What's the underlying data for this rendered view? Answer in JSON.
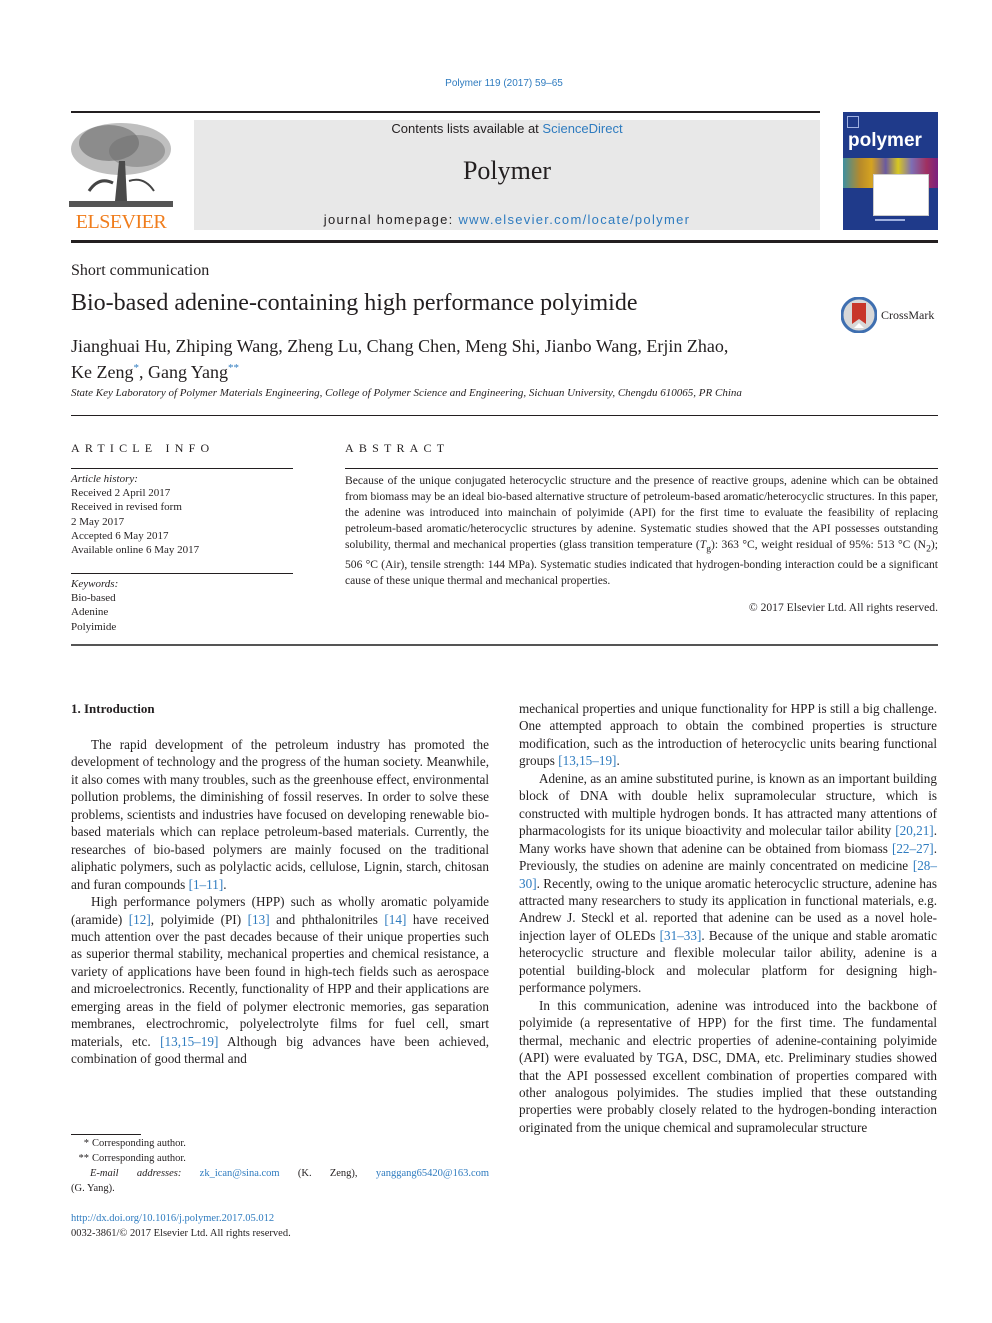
{
  "header": {
    "journal_ref": "Polymer 119 (2017) 59–65",
    "publisher_logo_text": "ELSEVIER",
    "contents_prefix": "Contents lists available at ",
    "contents_link": "ScienceDirect",
    "journal_name": "Polymer",
    "homepage_prefix": "journal homepage: ",
    "homepage_link": "www.elsevier.com/locate/polymer",
    "cover_title": "polymer",
    "brand_color": "#f07d1c",
    "link_color": "#2e7bbf"
  },
  "article": {
    "type": "Short communication",
    "title": "Bio-based adenine-containing high performance polyimide",
    "crossmark_label": "CrossMark",
    "authors_line1": "Jianghuai Hu, Zhiping Wang, Zheng Lu, Chang Chen, Meng Shi, Jianbo Wang, Erjin Zhao,",
    "author_zeng": "Ke Zeng",
    "author_zeng_mark": "*",
    "author_sep": ", ",
    "author_yang": "Gang Yang",
    "author_yang_mark": "**",
    "affiliation": "State Key Laboratory of Polymer Materials Engineering, College of Polymer Science and Engineering, Sichuan University, Chengdu 610065, PR China"
  },
  "article_info": {
    "heading": "ARTICLE INFO",
    "history_heading": "Article history:",
    "history": [
      "Received 2 April 2017",
      "Received in revised form",
      "2 May 2017",
      "Accepted 6 May 2017",
      "Available online 6 May 2017"
    ],
    "keywords_heading": "Keywords:",
    "keywords": [
      "Bio-based",
      "Adenine",
      "Polyimide"
    ]
  },
  "abstract": {
    "heading": "ABSTRACT",
    "p1": "Because of the unique conjugated heterocyclic structure and the presence of reactive groups, adenine which can be obtained from biomass may be an ideal bio-based alternative structure of petroleum-based aromatic/heterocyclic structures. In this paper, the adenine was introduced into mainchain of polyimide (API) for the first time to evaluate the feasibility of replacing petroleum-based aromatic/heterocyclic structures by adenine. Systematic studies showed that the API possesses outstanding solubility, thermal and mechanical properties (glass transition temperature (",
    "tg_symbol": "T",
    "tg_sub": "g",
    "p2": "): 363 °C, weight residual of 95%: 513 °C (N",
    "n2_sub": "2",
    "p3": "); 506 °C (Air), tensile strength: 144 MPa). Systematic studies indicated that hydrogen-bonding interaction could be a significant cause of these unique thermal and mechanical properties.",
    "copyright": "© 2017 Elsevier Ltd. All rights reserved."
  },
  "body": {
    "section_heading": "1.  Introduction",
    "left": {
      "p1": "The rapid development of the petroleum industry has promoted the development of technology and the progress of the human society. Meanwhile, it also comes with many troubles, such as the greenhouse effect, environmental pollution problems, the diminishing of fossil reserves. In order to solve these problems, scientists and industries have focused on developing renewable bio-based materials which can replace petroleum-based materials. Currently, the researches of bio-based polymers are mainly focused on the traditional aliphatic polymers, such as polylactic acids, cellulose, Lignin, starch, chitosan and furan compounds ",
      "p1_ref": "[1–11]",
      "p1_end": ".",
      "p2_a": "High performance polymers (HPP) such as wholly aromatic polyamide (aramide) ",
      "p2_ref1": "[12]",
      "p2_b": ", polyimide (PI) ",
      "p2_ref2": "[13]",
      "p2_c": " and phthalonitriles ",
      "p2_ref3": "[14]",
      "p2_d": " have received much attention over the past decades because of their unique properties such as superior thermal stability, mechanical properties and chemical resistance, a variety of applications have been found in high-tech fields such as aerospace and microelectronics. Recently, functionality of HPP and their applications are emerging areas in the field of polymer electronic memories, gas separation membranes, electrochromic, polyelectrolyte films for fuel cell, smart materials, etc. ",
      "p2_ref4": "[13,15–19]",
      "p2_e": " Although big advances have been achieved, combination of good thermal and"
    },
    "right": {
      "p0_a": "mechanical properties and unique functionality for HPP is still a big challenge. One attempted approach to obtain the combined properties is structure modification, such as the introduction of heterocyclic units bearing functional groups ",
      "p0_ref": "[13,15–19]",
      "p0_end": ".",
      "p1_a": "Adenine, as an amine substituted purine, is known as an important building block of DNA with double helix supramolecular structure, which is constructed with multiple hydrogen bonds. It has attracted many attentions of pharmacologists for its unique bioactivity and molecular tailor ability ",
      "p1_ref1": "[20,21]",
      "p1_b": ". Many works have shown that adenine can be obtained from biomass ",
      "p1_ref2": "[22–27]",
      "p1_c": ". Previously, the studies on adenine are mainly concentrated on medicine ",
      "p1_ref3": "[28–30]",
      "p1_d": ". Recently, owing to the unique aromatic heterocyclic structure, adenine has attracted many researchers to study its application in functional materials, e.g. Andrew J. Steckl et al. reported that adenine can be used as a novel hole-injection layer of OLEDs ",
      "p1_ref4": "[31–33]",
      "p1_e": ". Because of the unique and stable aromatic heterocyclic structure and flexible molecular tailor ability, adenine is a potential building-block and molecular platform for designing high-performance polymers.",
      "p2": "In this communication, adenine was introduced into the backbone of polyimide (a representative of HPP) for the first time. The fundamental thermal, mechanic and electric properties of adenine-containing polyimide (API) were evaluated by TGA, DSC, DMA, etc. Preliminary studies showed that the API possessed excellent combination of properties compared with other analogous polyimides. The studies implied that these outstanding properties were probably closely related to the hydrogen-bonding interaction originated from the unique chemical and supramolecular structure"
    }
  },
  "footnotes": {
    "star1": "*",
    "star1_text": "Corresponding author.",
    "star2": "**",
    "star2_text": "Corresponding author.",
    "email_label": "E-mail addresses:",
    "email1": "zk_ican@sina.com",
    "email1_name": "(K. Zeng),",
    "email2": "yanggang65420@163.com",
    "email2_name": "(G. Yang).",
    "doi": "http://dx.doi.org/10.1016/j.polymer.2017.05.012",
    "issn_copyright": "0032-3861/© 2017 Elsevier Ltd. All rights reserved."
  }
}
